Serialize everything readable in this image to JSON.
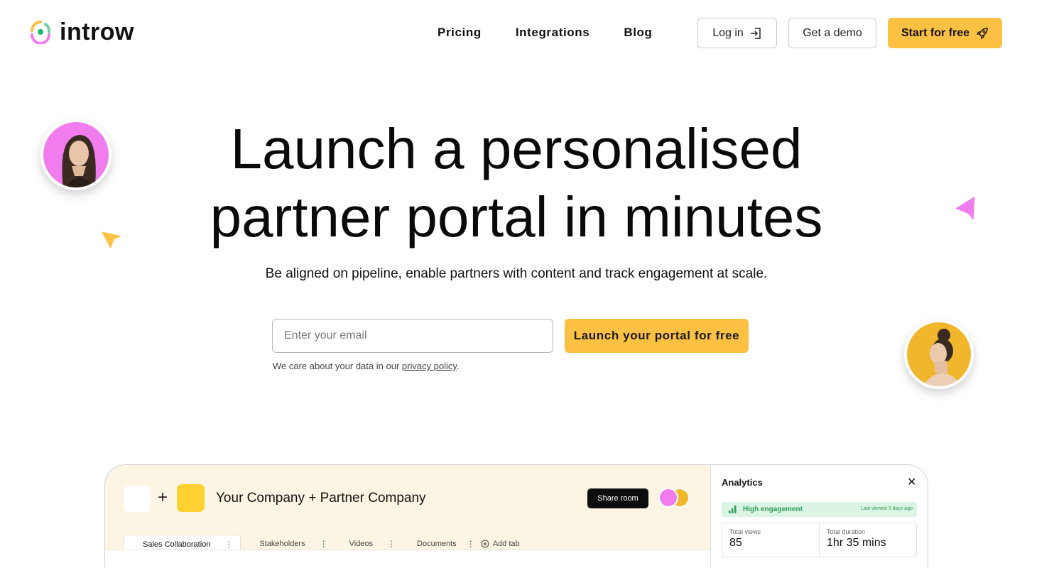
{
  "brand": {
    "name": "introw"
  },
  "nav": {
    "links": [
      "Pricing",
      "Integrations",
      "Blog"
    ],
    "login_label": "Log in",
    "demo_label": "Get a demo",
    "start_label": "Start for free"
  },
  "hero": {
    "title_line1": "Launch a personalised",
    "title_line2": "partner portal in minutes",
    "subtitle": "Be aligned on pipeline, enable partners with content and track engagement at scale.",
    "email_placeholder": "Enter your email",
    "cta_label": "Launch your portal for free",
    "privacy_text": "We care about your data in our",
    "privacy_link": "privacy policy",
    "privacy_end": "."
  },
  "mockup": {
    "title": "Your Company + Partner Company",
    "plus": "+",
    "share_label": "Share room",
    "tabs": [
      {
        "label": "Sales Collaboration",
        "active": true
      },
      {
        "label": "Stakeholders"
      },
      {
        "label": "Videos"
      },
      {
        "label": "Documents"
      }
    ],
    "add_tab_label": "Add tab",
    "analytics": {
      "title": "Analytics",
      "close": "✕",
      "engagement_label": "High engagement",
      "engagement_time": "Last viewed 3 days ago",
      "stats": [
        {
          "label": "Total views",
          "value": "85"
        },
        {
          "label": "Total duration",
          "value": "1hr 35 mins"
        }
      ]
    }
  },
  "colors": {
    "accent": "#fcc042",
    "pink": "#f07cee",
    "engagement_green": "#2e9a57"
  }
}
